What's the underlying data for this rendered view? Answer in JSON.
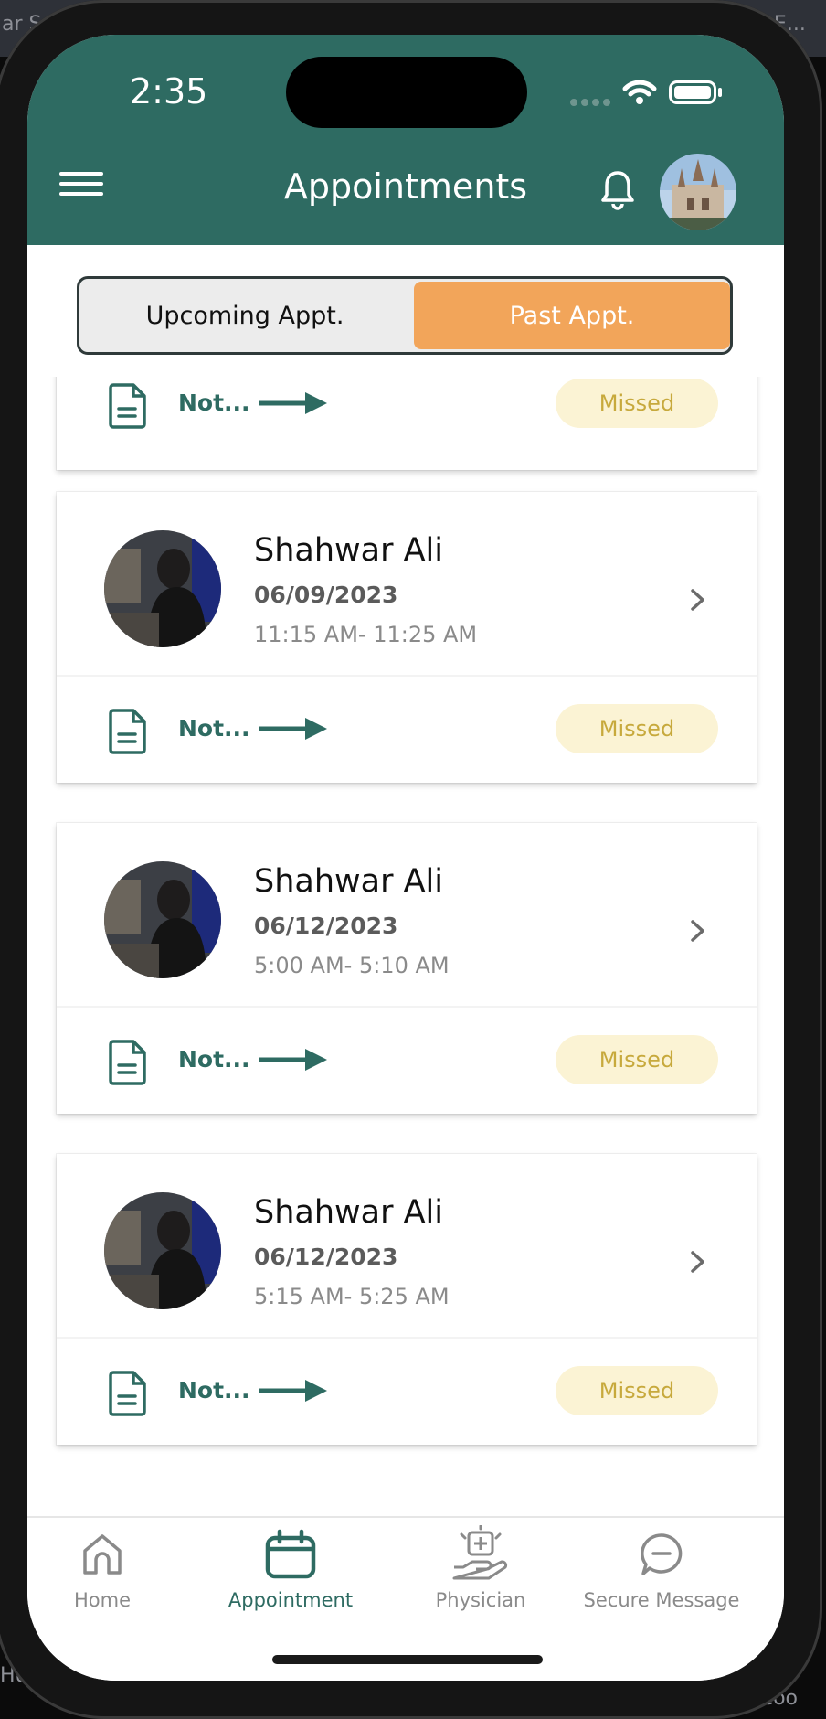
{
  "background": {
    "left_text": "ar Sc",
    "right_text": "h E...",
    "bottom_left_text": "Hub,",
    "bottom_right_text": "ge coo"
  },
  "status_bar": {
    "time": "2:35"
  },
  "header": {
    "title": "Appointments",
    "color": "#2e6b62"
  },
  "segmented": {
    "upcoming_label": "Upcoming Appt.",
    "past_label": "Past Appt.",
    "active": "past",
    "accent": "#f2a55a"
  },
  "appointments": [
    {
      "name": "",
      "date": "",
      "time": "",
      "notes": "Not...",
      "status": "Missed"
    },
    {
      "name": "Shahwar Ali",
      "date": "06/09/2023",
      "time": "11:15 AM- 11:25 AM",
      "notes": "Not...",
      "status": "Missed"
    },
    {
      "name": "Shahwar Ali",
      "date": "06/12/2023",
      "time": "5:00 AM- 5:10 AM",
      "notes": "Not...",
      "status": "Missed"
    },
    {
      "name": "Shahwar Ali",
      "date": "06/12/2023",
      "time": "5:15 AM- 5:25 AM",
      "notes": "Not...",
      "status": "Missed"
    }
  ],
  "tabbar": {
    "items": [
      {
        "label": "Home",
        "icon": "home-icon"
      },
      {
        "label": "Appointment",
        "icon": "calendar-icon",
        "active": true
      },
      {
        "label": "Physician",
        "icon": "physician-icon"
      },
      {
        "label": "Secure Message",
        "icon": "message-icon"
      }
    ]
  }
}
